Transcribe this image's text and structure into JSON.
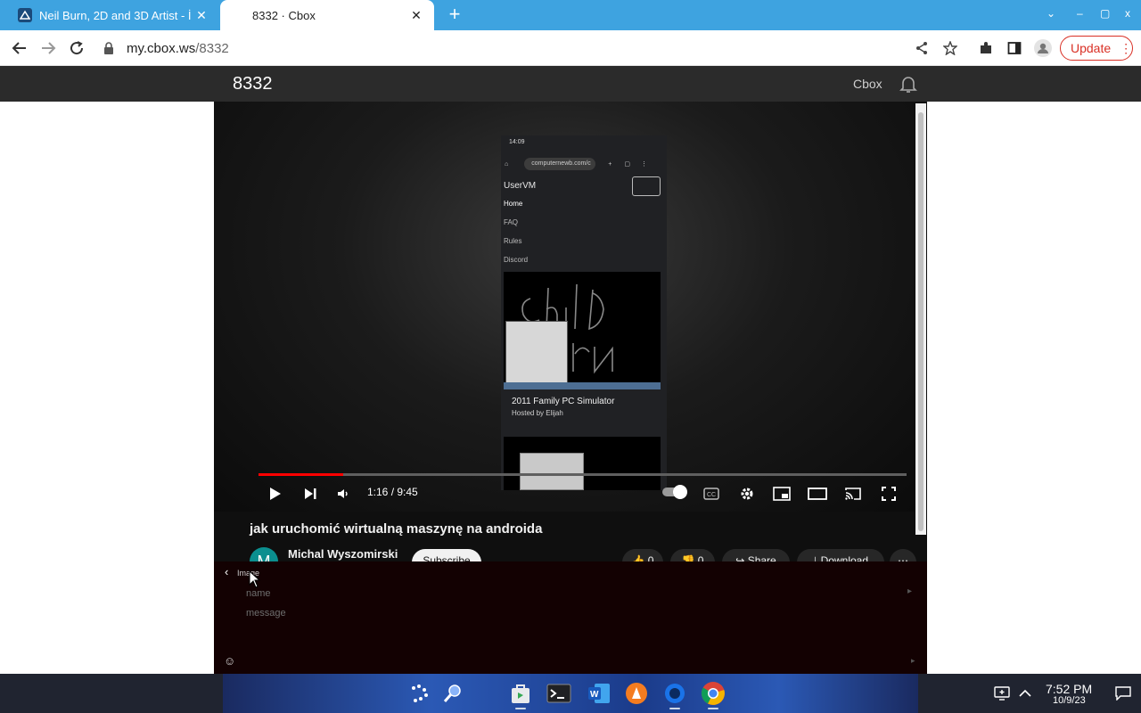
{
  "browser": {
    "tabs": [
      {
        "title": "Neil Burn, 2D and 3D Artist - İ",
        "active": false
      },
      {
        "title": "8332 · Cbox",
        "active": true
      }
    ],
    "new_tab_symbol": "+",
    "window_controls": [
      "⌄",
      "–",
      "▢",
      "x"
    ],
    "url": {
      "domain": "my.cbox.ws",
      "path": "/8332"
    },
    "update_label": "Update",
    "accent": "#3ea3e0"
  },
  "cbox": {
    "box_id": "8332",
    "brand": "Cbox",
    "icons": [
      "bell-icon"
    ]
  },
  "youtube": {
    "phone": {
      "status_time": "14:09",
      "address": "computernewb.com/c",
      "site_name": "UserVM",
      "nav_items": [
        "Home",
        "FAQ",
        "Rules",
        "Discord"
      ],
      "card_title": "2011 Family PC Simulator",
      "card_host": "Hosted by Elijah"
    },
    "player": {
      "current_time": "1:16",
      "duration": "9:45",
      "time_display": "1:16 / 9:45",
      "progress_fraction": 0.13
    },
    "video_title": "jak uruchomić wirtualną maszynę na androida",
    "channel_initial": "M",
    "channel_name": "Michal Wyszomirski",
    "subscribe_label": "Subscribe",
    "like_count": "0",
    "dislike_count": "0",
    "share_label": "Share",
    "download_label": "Download",
    "more_symbol": "⋯"
  },
  "chat": {
    "back_symbol": "‹",
    "image_label": "Image",
    "name_placeholder": "name",
    "message_placeholder": "message",
    "emoji_symbol": "☺",
    "send_symbol": "▸"
  },
  "taskbar": {
    "time": "7:52 PM",
    "date": "10/9/23",
    "apps": [
      "launcher-icon",
      "search-icon",
      "store-icon",
      "terminal-icon",
      "word-icon",
      "vlc-icon",
      "circle-app-icon",
      "chrome-icon"
    ]
  }
}
